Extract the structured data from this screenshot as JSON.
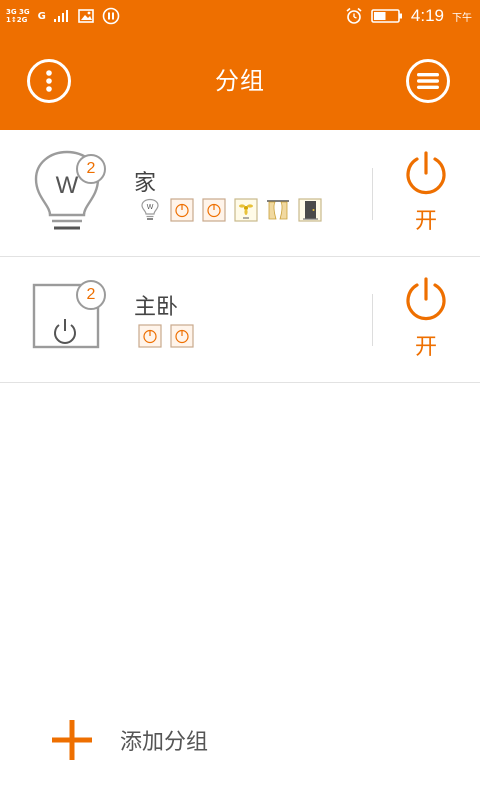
{
  "status_bar": {
    "network_line1": "3G 3G",
    "network_line2": "1↕2G",
    "carrier_signal": "G",
    "time": "4:19",
    "ampm": "下午",
    "battery_level": 0.5
  },
  "header": {
    "title": "分组",
    "left_icon": "more-vertical-icon",
    "right_icon": "menu-icon"
  },
  "groups": [
    {
      "name": "家",
      "badge_count": "2",
      "icon": "lightbulb-icon",
      "icon_letter": "W",
      "devices": [
        "lightbulb-icon",
        "socket-icon",
        "socket-icon",
        "fan-icon",
        "curtain-icon",
        "door-icon"
      ],
      "power_label": "开"
    },
    {
      "name": "主卧",
      "badge_count": "2",
      "icon": "socket-icon",
      "devices": [
        "socket-icon",
        "socket-icon"
      ],
      "power_label": "开"
    }
  ],
  "add_group": {
    "label": "添加分组",
    "icon": "plus-icon"
  },
  "colors": {
    "accent": "#EE6F00",
    "text": "#444444",
    "icon_gray": "#9b9b9b"
  }
}
